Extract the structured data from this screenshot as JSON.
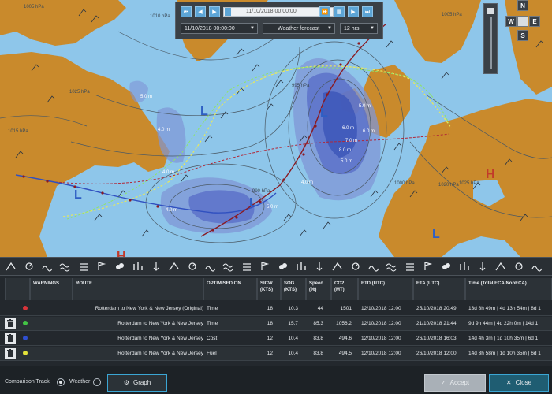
{
  "playback": {
    "timeline_value": "11/10/2018 00:00:00",
    "date_value": "11/10/2018 00:00:00",
    "layer_value": "Weather forecast",
    "interval_value": "12 hrs",
    "buttons": {
      "first": "⏮",
      "prev": "◀",
      "play": "▶",
      "fast": "⏩",
      "calendar": "▦",
      "next": "▶",
      "last": "⏭"
    }
  },
  "compass": {
    "n": "N",
    "w": "W",
    "e": "E",
    "s": "S"
  },
  "map": {
    "pressure_centers": [
      {
        "symbol": "L",
        "color": "#2e5fc4"
      },
      {
        "symbol": "L",
        "color": "#2e5fc4"
      },
      {
        "symbol": "L",
        "color": "#2e5fc4"
      },
      {
        "symbol": "L",
        "color": "#2e5fc4"
      },
      {
        "symbol": "L",
        "color": "#2e5fc4"
      },
      {
        "symbol": "H",
        "color": "#c23a2a"
      },
      {
        "symbol": "H",
        "color": "#c23a2a"
      }
    ],
    "wave_labels": [
      "5.0 m",
      "6.0 m",
      "7.0 m",
      "8.0 m",
      "6.0 m",
      "5.0 m",
      "4.0 m",
      "4.0 m",
      "4.0 m",
      "5.0 m",
      "4.0 m",
      "5.0 m"
    ],
    "isobar_labels": [
      "1005 hPa",
      "1010 hPa",
      "1025 hPa",
      "1015 hPa",
      "990 hPa",
      "995 hPa",
      "1000 hPa",
      "1020 hPa",
      "1025 hPa",
      "1005 hPa"
    ],
    "colors": {
      "sea": "#8ec6ea",
      "land": "#c98a2c",
      "high_waves": "#3b55b8",
      "route_green": "#8fe36a",
      "route_yellow": "#e9e95a",
      "route_red": "#b12738",
      "route_blue": "#3050c0",
      "route_dark_red": "#8a1a22"
    }
  },
  "toolbar": {
    "icons": [
      "wind-arrow-icon",
      "pressure-icon",
      "wave-direction-icon",
      "swell-icon",
      "current-icon",
      "gust-icon",
      "sea-state-icon",
      "wave-height-icon",
      "wind-speed-icon",
      "wave-period-icon",
      "swell-height-icon",
      "swell-period-icon",
      "temperature-air-icon",
      "temperature-sea-icon",
      "visibility-icon",
      "precipitation-icon",
      "cloud-icon",
      "rain-icon",
      "thunder-icon",
      "ice-icon",
      "snow-icon",
      "fog-icon",
      "tropical-storm-icon",
      "thermometer-icon",
      "thermometer-sea-icon",
      "ice-edge-icon",
      "icebergs-icon",
      "layers-icon",
      "fish-icon",
      "settings-icon"
    ]
  },
  "table": {
    "headers": [
      {
        "key": "warnings",
        "label": "WARNINGS"
      },
      {
        "key": "route",
        "label": "ROUTE"
      },
      {
        "key": "optimised",
        "label": "OPTIMISED ON"
      },
      {
        "key": "sicw",
        "label": "SICW (KTS)"
      },
      {
        "key": "sog",
        "label": "SOG (KTS)"
      },
      {
        "key": "speed",
        "label": "Speed (%)"
      },
      {
        "key": "co2",
        "label": "CO2 (MT)"
      },
      {
        "key": "etd",
        "label": "ETD (UTC)"
      },
      {
        "key": "eta",
        "label": "ETA (UTC)"
      },
      {
        "key": "time",
        "label": "Time (Total|ECA|NonECA)"
      }
    ],
    "rows": [
      {
        "color": "#d8343a",
        "route": "Rotterdam to New York & New Jersey (Original)",
        "optimised": "Time",
        "sicw": "18",
        "sog": "10.3",
        "speed": "44",
        "co2": "1501",
        "etd": "12/10/2018 12:00",
        "eta": "25/10/2018 20:49",
        "time": "13d 8h 49m | 4d 13h 54m | 8d 1"
      },
      {
        "color": "#43c445",
        "route": "Rotterdam to New York & New Jersey",
        "optimised": "Time",
        "sicw": "18",
        "sog": "15.7",
        "speed": "85.3",
        "co2": "1056.2",
        "etd": "12/10/2018 12:00",
        "eta": "21/10/2018 21:44",
        "time": "9d 9h 44m | 4d 22h 0m | 14d 1"
      },
      {
        "color": "#2f4fd1",
        "route": "Rotterdam to New York & New Jersey",
        "optimised": "Cost",
        "sicw": "12",
        "sog": "10.4",
        "speed": "83.8",
        "co2": "494.6",
        "etd": "12/10/2018 12:00",
        "eta": "26/10/2018 16:03",
        "time": "14d 4h 3m | 1d 10h 35m | 6d 1"
      },
      {
        "color": "#e3e23a",
        "route": "Rotterdam to New York & New Jersey",
        "optimised": "Fuel",
        "sicw": "12",
        "sog": "10.4",
        "speed": "83.8",
        "co2": "494.5",
        "etd": "12/10/2018 12:00",
        "eta": "26/10/2018 12:00",
        "time": "14d 3h 58m | 1d 10h 35m | 6d 1"
      }
    ]
  },
  "footer": {
    "comparison_label": "Comparison Track",
    "weather_label": "Weather",
    "graph_label": "Graph",
    "accept_label": "Accept",
    "close_label": "Close"
  }
}
